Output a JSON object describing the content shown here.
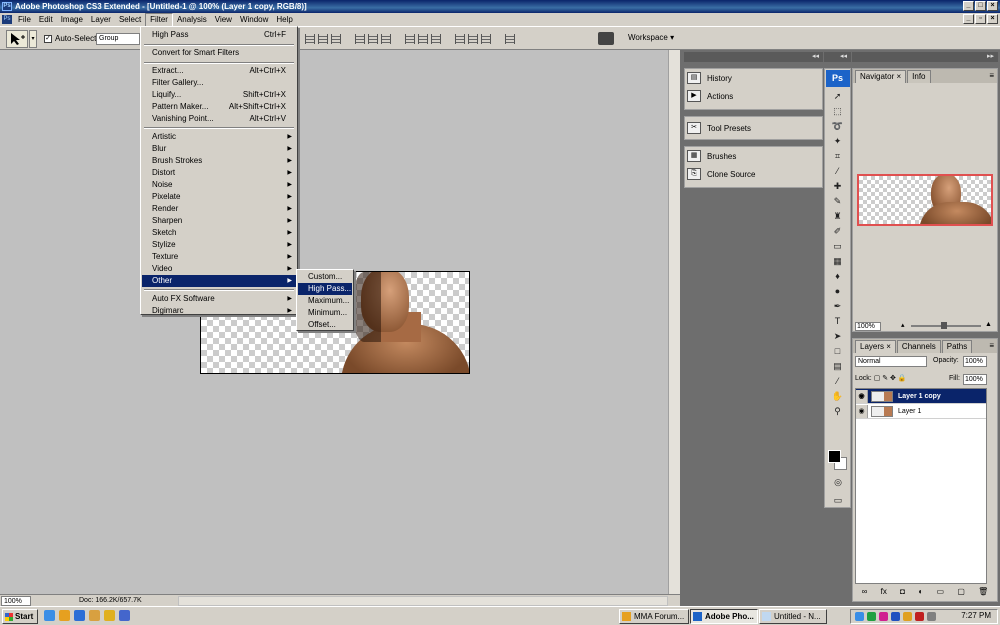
{
  "window": {
    "title": "Adobe Photoshop CS3 Extended - [Untitled-1 @ 100% (Layer 1 copy, RGB/8)]",
    "app_icon": "Ps"
  },
  "menubar": [
    "File",
    "Edit",
    "Image",
    "Layer",
    "Select",
    "Filter",
    "Analysis",
    "View",
    "Window",
    "Help"
  ],
  "options": {
    "auto_select_label": "Auto-Select:",
    "auto_select_value": "Group",
    "workspace_label": "Workspace ▾"
  },
  "filter_menu": {
    "items": [
      {
        "label": "High Pass",
        "shortcut": "Ctrl+F"
      },
      {
        "label": "Convert for Smart Filters"
      },
      {
        "label": "Extract...",
        "shortcut": "Alt+Ctrl+X"
      },
      {
        "label": "Filter Gallery..."
      },
      {
        "label": "Liquify...",
        "shortcut": "Shift+Ctrl+X"
      },
      {
        "label": "Pattern Maker...",
        "shortcut": "Alt+Shift+Ctrl+X"
      },
      {
        "label": "Vanishing Point...",
        "shortcut": "Alt+Ctrl+V"
      },
      {
        "label": "Artistic"
      },
      {
        "label": "Blur"
      },
      {
        "label": "Brush Strokes"
      },
      {
        "label": "Distort"
      },
      {
        "label": "Noise"
      },
      {
        "label": "Pixelate"
      },
      {
        "label": "Render"
      },
      {
        "label": "Sharpen"
      },
      {
        "label": "Sketch"
      },
      {
        "label": "Stylize"
      },
      {
        "label": "Texture"
      },
      {
        "label": "Video"
      },
      {
        "label": "Other"
      },
      {
        "label": "Auto FX Software"
      },
      {
        "label": "Digimarc"
      }
    ]
  },
  "other_submenu": [
    "Custom...",
    "High Pass...",
    "Maximum...",
    "Minimum...",
    "Offset..."
  ],
  "dock_panels": {
    "history": "History",
    "actions": "Actions",
    "tool_presets": "Tool Presets",
    "brushes": "Brushes",
    "clone_source": "Clone Source"
  },
  "navigator": {
    "tabs": [
      "Navigator",
      "Info"
    ],
    "zoom": "100%"
  },
  "layers": {
    "tabs": [
      "Layers",
      "Channels",
      "Paths"
    ],
    "blend_mode": "Normal",
    "opacity_label": "Opacity:",
    "opacity_value": "100%",
    "lock_label": "Lock:",
    "fill_label": "Fill:",
    "fill_value": "100%",
    "items": [
      "Layer 1 copy",
      "Layer 1"
    ]
  },
  "status": {
    "zoom": "100%",
    "doc": "Doc: 166.2K/657.7K"
  },
  "taskbar": {
    "start": "Start",
    "tasks": [
      "MMA Forum...",
      "Adobe Pho...",
      "Untitled - N..."
    ],
    "clock": "7:27 PM"
  },
  "colors": {
    "title_bar": "#0a246a",
    "menu_highlight": "#0a246a",
    "panel_bg": "#d4d0c8",
    "dock_bg": "#6e6e6e",
    "navigator_box": "#e05050"
  },
  "icons": {
    "toolbox": [
      "move-tool-icon",
      "marquee-tool-icon",
      "lasso-tool-icon",
      "magic-wand-tool-icon",
      "crop-tool-icon",
      "eyedropper-tool-icon",
      "healing-brush-tool-icon",
      "brush-tool-icon",
      "clone-stamp-tool-icon",
      "history-brush-tool-icon",
      "eraser-tool-icon",
      "gradient-tool-icon",
      "blur-tool-icon",
      "dodge-tool-icon",
      "pen-tool-icon",
      "type-tool-icon",
      "path-selection-tool-icon",
      "shape-tool-icon",
      "notes-tool-icon",
      "eyedropper2-tool-icon",
      "hand-tool-icon",
      "zoom-tool-icon"
    ]
  }
}
